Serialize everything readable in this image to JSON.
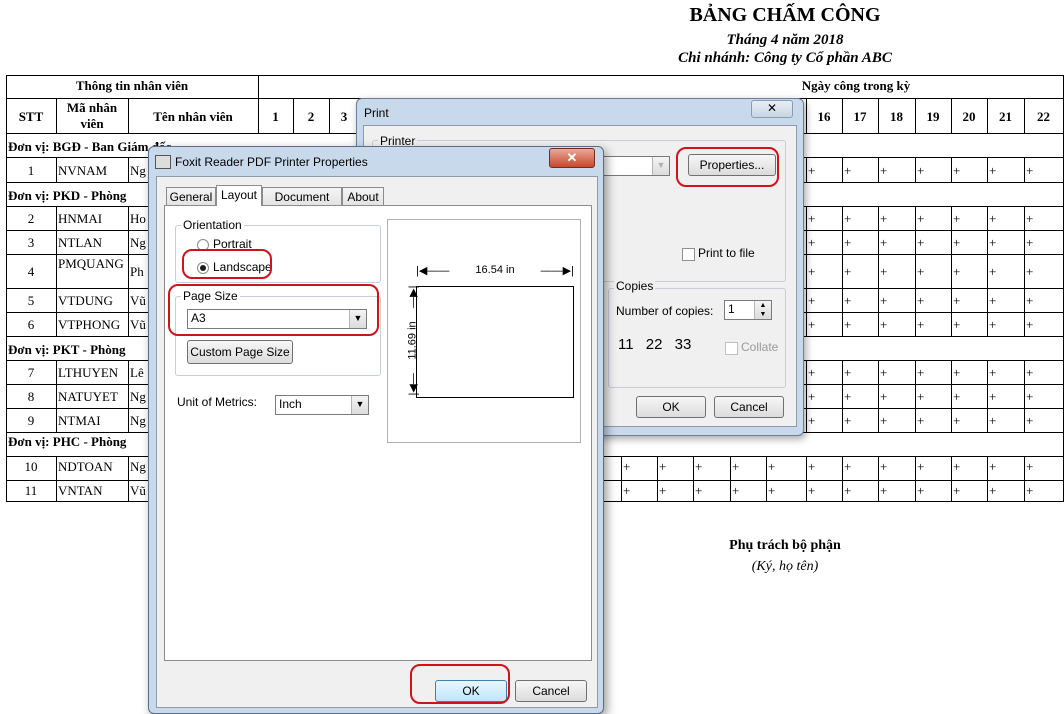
{
  "sheet": {
    "title": "BẢNG CHẤM CÔNG",
    "month": "Tháng 4 năm 2018",
    "branch": "Chi nhánh: Công ty Cổ phần ABC",
    "header_info": "Thông tin nhân viên",
    "header_days": "Ngày công trong kỳ",
    "col_stt": "STT",
    "col_ma": "Mã nhân viên",
    "col_ten": "Tên nhân viên",
    "day_cols": [
      "1",
      "2",
      "3",
      "16",
      "17",
      "18",
      "19",
      "20",
      "21",
      "22"
    ],
    "units": [
      "Đơn vị: BGĐ - Ban Giám đốc",
      "Đơn vị: PKD - Phòng",
      "Đơn vị: PKT - Phòng",
      "Đơn vị: PHC - Phòng"
    ],
    "rows": [
      {
        "stt": "1",
        "ma": "NVNAM",
        "ten": "Ng"
      },
      {
        "stt": "2",
        "ma": "HNMAI",
        "ten": "Ho"
      },
      {
        "stt": "3",
        "ma": "NTLAN",
        "ten": "Ng"
      },
      {
        "stt": "4",
        "ma": "PMQUANG",
        "ten": "Ph"
      },
      {
        "stt": "5",
        "ma": "VTDUNG",
        "ten": "Vũ"
      },
      {
        "stt": "6",
        "ma": "VTPHONG",
        "ten": "Vũ"
      },
      {
        "stt": "7",
        "ma": "LTHUYEN",
        "ten": "Lê"
      },
      {
        "stt": "8",
        "ma": "NATUYET",
        "ten": "Ng"
      },
      {
        "stt": "9",
        "ma": "NTMAI",
        "ten": "Ng"
      },
      {
        "stt": "10",
        "ma": "NDTOAN",
        "ten": "Ng"
      },
      {
        "stt": "11",
        "ma": "VNTAN",
        "ten": "Vũ"
      }
    ],
    "mark": "+",
    "signature_title": "Phụ trách bộ phận",
    "signature_note": "(Ký, họ tên)"
  },
  "print_dialog": {
    "title": "Print",
    "printer_group": "Printer",
    "properties_label": "Properties...",
    "print_to_file": "Print to file",
    "copies_group": "Copies",
    "number_of_copies_label": "Number of copies:",
    "copies_value": "1",
    "collate_label": "Collate",
    "collate_icons": [
      "1",
      "1",
      "2",
      "2",
      "3",
      "3"
    ],
    "ok_label": "OK",
    "cancel_label": "Cancel",
    "close_glyph": "✕"
  },
  "properties_dialog": {
    "title": "Foxit Reader PDF Printer Properties",
    "close_glyph": "✕",
    "tabs": [
      "General",
      "Layout",
      "Document Info",
      "About"
    ],
    "active_tab": "Layout",
    "orientation_group": "Orientation",
    "portrait_label": "Portrait",
    "landscape_label": "Landscape",
    "selected_orientation": "Landscape",
    "page_size_group": "Page Size",
    "page_size_value": "A3",
    "custom_page_size_label": "Custom Page Size",
    "unit_label": "Unit of Metrics:",
    "unit_value": "Inch",
    "preview_width": "16.54 in",
    "preview_height": "11.69 in",
    "ok_label": "OK",
    "cancel_label": "Cancel"
  },
  "colors": {
    "highlight": "#d0121b",
    "dialog_frame": "#c9d9ec",
    "dialog_body": "#f0f0f0"
  }
}
